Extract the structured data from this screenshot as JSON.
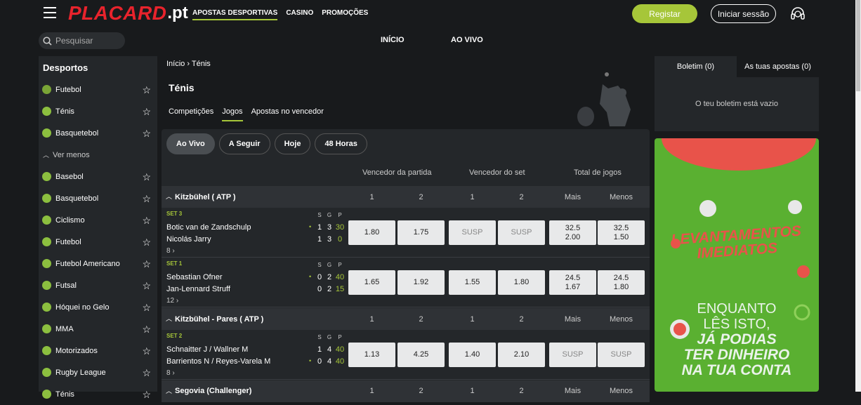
{
  "header": {
    "brand": "PLACARD",
    "brand_suffix": ".pt",
    "nav": [
      "APOSTAS DESPORTIVAS",
      "CASINO",
      "PROMOÇÕES"
    ],
    "register": "Registar",
    "login": "Iniciar sessão",
    "search_placeholder": "Pesquisar",
    "main_tabs": [
      "INÍCIO",
      "AO VIVO"
    ]
  },
  "sidebar": {
    "title": "Desportos",
    "favorites": [
      "Futebol",
      "Ténis",
      "Basquetebol"
    ],
    "toggle": "Ver menos",
    "items": [
      "Basebol",
      "Basquetebol",
      "Ciclismo",
      "Futebol",
      "Futebol Americano",
      "Futsal",
      "Hóquei no Gelo",
      "MMA",
      "Motorizados",
      "Rugby League",
      "Ténis"
    ]
  },
  "content": {
    "breadcrumb_home": "Início",
    "breadcrumb_current": "Ténis",
    "title": "Ténis",
    "tabs": [
      "Competições",
      "Jogos",
      "Apostas no vencedor"
    ],
    "filters": [
      "Ao Vivo",
      "A Seguir",
      "Hoje",
      "48 Horas"
    ],
    "markets": [
      "Vencedor da partida",
      "Vencedor do set",
      "Total de jogos"
    ],
    "col_labels": [
      "1",
      "2",
      "1",
      "2",
      "Mais",
      "Menos"
    ],
    "score_labels": [
      "S",
      "G",
      "P"
    ],
    "leagues": [
      {
        "name": "Kitzbühel ( ATP )",
        "matches": [
          {
            "set": "SET 3",
            "p1": "Botic van de Zandschulp",
            "p2": "Nicolás Jarry",
            "s1": [
              "1",
              "3",
              "30"
            ],
            "s2": [
              "1",
              "3",
              "0"
            ],
            "more": "8",
            "odds": [
              "1.80",
              "1.75",
              "SUSP",
              "SUSP"
            ],
            "tot_mais": [
              "32.5",
              "2.00"
            ],
            "tot_menos": [
              "32.5",
              "1.50"
            ]
          },
          {
            "set": "SET 1",
            "p1": "Sebastian Ofner",
            "p2": "Jan-Lennard Struff",
            "s1": [
              "0",
              "2",
              "40"
            ],
            "s2": [
              "0",
              "2",
              "15"
            ],
            "more": "12",
            "odds": [
              "1.65",
              "1.92",
              "1.55",
              "1.80"
            ],
            "tot_mais": [
              "24.5",
              "1.67"
            ],
            "tot_menos": [
              "24.5",
              "1.80"
            ]
          }
        ]
      },
      {
        "name": "Kitzbühel - Pares ( ATP )",
        "matches": [
          {
            "set": "SET 2",
            "p1": "Schnaitter J / Wallner M",
            "p2": "Barrientos N / Reyes-Varela M",
            "s1": [
              "1",
              "4",
              "40"
            ],
            "s2": [
              "0",
              "4",
              "40"
            ],
            "more": "8",
            "odds": [
              "1.13",
              "4.25",
              "1.40",
              "2.10"
            ],
            "tot_mais": [
              "SUSP"
            ],
            "tot_menos": [
              "SUSP"
            ]
          }
        ]
      },
      {
        "name": "Segovia (Challenger)",
        "matches": []
      }
    ]
  },
  "betslip": {
    "tab1": "Boletim (0)",
    "tab2": "As tuas apostas (0)",
    "empty": "O teu boletim está vazio"
  },
  "banner": {
    "headline1": "LEVANTAMENTOS",
    "headline2": "IMEDIATOS",
    "line1": "ENQUANTO",
    "line2": "LÊS ISTO,",
    "line3": "JÁ PODIAS",
    "line4": "TER DINHEIRO",
    "line5": "NA TUA CONTA"
  },
  "colors": {
    "accent": "#a6c639",
    "brand_red": "#e8232c",
    "banner_green": "#5ab031"
  }
}
